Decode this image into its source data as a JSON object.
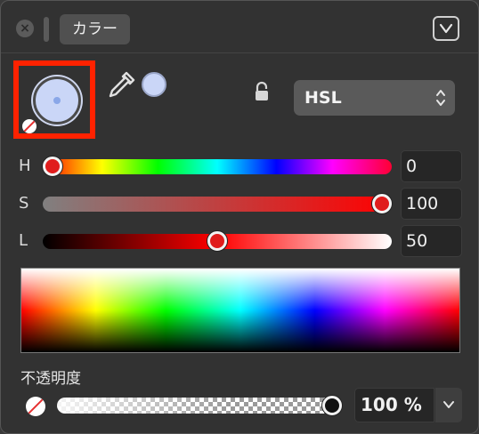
{
  "header": {
    "tab_label": "カラー",
    "close_icon": "close-icon",
    "collapse_icon": "chevron-down-icon"
  },
  "color": {
    "swatch_color": "#cad6f7",
    "mode": "HSL",
    "lock_icon": "lock-icon",
    "eyedropper_icon": "eyedropper-icon"
  },
  "sliders": {
    "h": {
      "label": "H",
      "value": "0"
    },
    "s": {
      "label": "S",
      "value": "100"
    },
    "l": {
      "label": "L",
      "value": "50"
    }
  },
  "opacity": {
    "label": "不透明度",
    "value": "100 %"
  },
  "accent": {
    "highlight": "#ff2200",
    "thumb": "#e01c1c"
  }
}
